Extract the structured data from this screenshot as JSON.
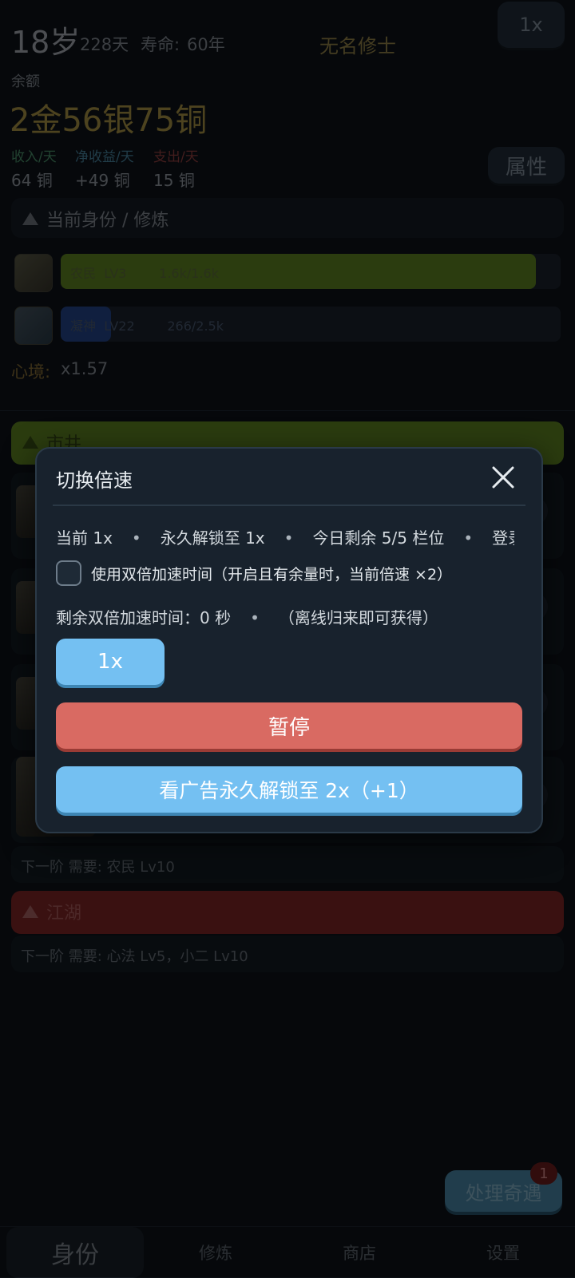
{
  "header": {
    "age": "18岁",
    "days": "228天",
    "lifespan_label": "寿命:",
    "lifespan_value": "60年",
    "player_name": "无名修士",
    "speed_button": "1x"
  },
  "balance": {
    "label": "余额",
    "value": "2金56银75铜"
  },
  "stats": {
    "income_label": "收入/天",
    "income_value": "64 铜",
    "net_label": "净收益/天",
    "net_value": "+49 铜",
    "expense_label": "支出/天",
    "expense_value": "15 铜",
    "income_color": "#3f7a5a",
    "net_color": "#3c6f86",
    "expense_color": "#7a3636"
  },
  "attributes_button": "属性",
  "identity_section": {
    "title": "当前身份 / 修炼",
    "rows": [
      {
        "name": "农民",
        "level": "LV3",
        "progress": "1.6k/1.6k",
        "fill": 1.0,
        "color": "#4f6e1c"
      },
      {
        "name": "凝神",
        "level": "LV22",
        "progress": "266/2.5k",
        "fill": 0.106,
        "color": "#1e3a73"
      }
    ]
  },
  "mood": {
    "label": "心境:",
    "value": "x1.57"
  },
  "market_section": {
    "title": "市井",
    "next_requirement": "下一阶 需要: 农民 Lv10"
  },
  "jianghu_section": {
    "title": "江湖",
    "next_requirement": "下一阶 需要: 心法 Lv5，小二 Lv10"
  },
  "event_button": {
    "label": "处理奇遇",
    "badge": "1"
  },
  "tabs": [
    {
      "label": "身份",
      "active": true
    },
    {
      "label": "修炼",
      "active": false
    },
    {
      "label": "商店",
      "active": false
    },
    {
      "label": "设置",
      "active": false
    }
  ],
  "modal": {
    "title": "切换倍速",
    "info_current": "当前 1x",
    "info_unlocked": "永久解锁至 1x",
    "info_today": "今日剩余 5/5 栏位",
    "info_login": "登录",
    "checkbox_label": "使用双倍加速时间（开启且有余量时，当前倍速 ×2）",
    "remaining_label": "剩余双倍加速时间：0 秒",
    "remaining_hint": "（离线归来即可获得）",
    "speed_option": "1x",
    "pause_button": "暂停",
    "ad_button": "看广告永久解锁至 2x（+1）"
  }
}
